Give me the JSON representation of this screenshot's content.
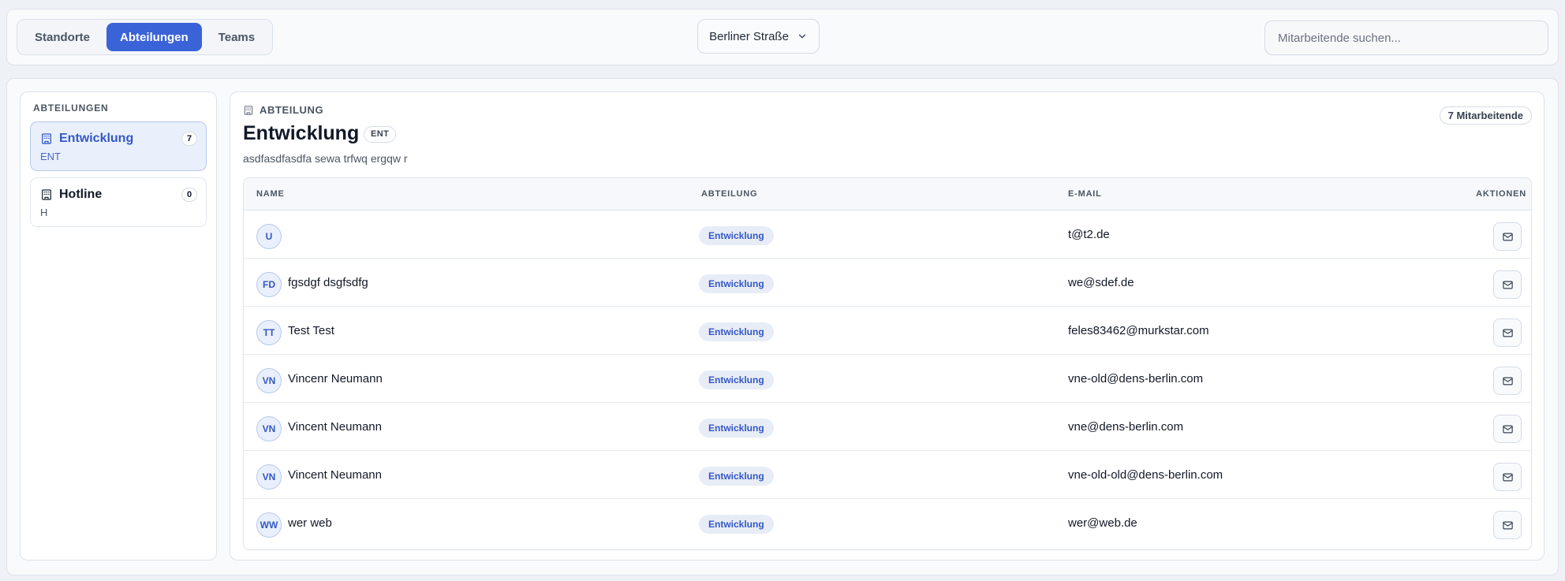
{
  "topbar": {
    "tabs": [
      {
        "label": "Standorte",
        "active": false
      },
      {
        "label": "Abteilungen",
        "active": true
      },
      {
        "label": "Teams",
        "active": false
      }
    ],
    "location": {
      "label": "Berliner Straße",
      "icon": "chevron-down-icon"
    },
    "search": {
      "placeholder": "Mitarbeitende suchen...",
      "value": ""
    }
  },
  "sidebar": {
    "title": "ABTEILUNGEN",
    "items": [
      {
        "name": "Entwicklung",
        "code": "ENT",
        "count": "7",
        "active": true,
        "icon": "building-icon"
      },
      {
        "name": "Hotline",
        "code": "H",
        "count": "0",
        "active": false,
        "icon": "building-icon"
      }
    ]
  },
  "detail": {
    "eyebrow": "ABTEILUNG",
    "title": "Entwicklung",
    "code": "ENT",
    "description": "asdfasdfasdfa sewa trfwq ergqw r",
    "count_label": "7 Mitarbeitende",
    "table": {
      "columns": [
        "NAME",
        "ABTEILUNG",
        "E-MAIL",
        "AKTIONEN"
      ],
      "rows": [
        {
          "initials": "U",
          "name": "",
          "department": "Entwicklung",
          "email": "t@t2.de"
        },
        {
          "initials": "FD",
          "name": "fgsdgf dsgfsdfg",
          "department": "Entwicklung",
          "email": "we@sdef.de"
        },
        {
          "initials": "TT",
          "name": "Test Test",
          "department": "Entwicklung",
          "email": "feles83462@murkstar.com"
        },
        {
          "initials": "VN",
          "name": "Vincenr Neumann",
          "department": "Entwicklung",
          "email": "vne-old@dens-berlin.com"
        },
        {
          "initials": "VN",
          "name": "Vincent Neumann",
          "department": "Entwicklung",
          "email": "vne@dens-berlin.com"
        },
        {
          "initials": "VN",
          "name": "Vincent Neumann",
          "department": "Entwicklung",
          "email": "vne-old-old@dens-berlin.com"
        },
        {
          "initials": "WW",
          "name": "wer web",
          "department": "Entwicklung",
          "email": "wer@web.de"
        }
      ]
    }
  },
  "colors": {
    "accent": "#3a63d8",
    "accent_text": "#3358c6",
    "accent_bg": "#e9effb",
    "background": "#eef1f5"
  }
}
